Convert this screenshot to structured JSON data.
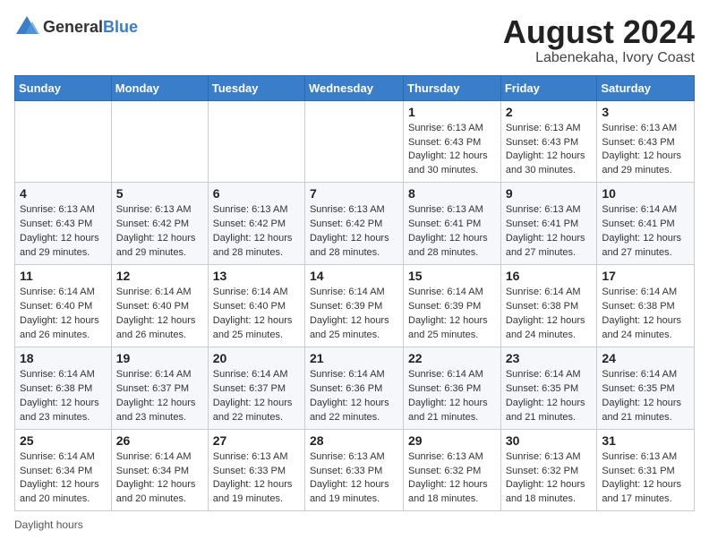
{
  "logo": {
    "general": "General",
    "blue": "Blue"
  },
  "title": "August 2024",
  "location": "Labenekaha, Ivory Coast",
  "days_header": [
    "Sunday",
    "Monday",
    "Tuesday",
    "Wednesday",
    "Thursday",
    "Friday",
    "Saturday"
  ],
  "footer": "Daylight hours",
  "weeks": [
    [
      {
        "day": "",
        "info": ""
      },
      {
        "day": "",
        "info": ""
      },
      {
        "day": "",
        "info": ""
      },
      {
        "day": "",
        "info": ""
      },
      {
        "day": "1",
        "info": "Sunrise: 6:13 AM\nSunset: 6:43 PM\nDaylight: 12 hours\nand 30 minutes."
      },
      {
        "day": "2",
        "info": "Sunrise: 6:13 AM\nSunset: 6:43 PM\nDaylight: 12 hours\nand 30 minutes."
      },
      {
        "day": "3",
        "info": "Sunrise: 6:13 AM\nSunset: 6:43 PM\nDaylight: 12 hours\nand 29 minutes."
      }
    ],
    [
      {
        "day": "4",
        "info": "Sunrise: 6:13 AM\nSunset: 6:43 PM\nDaylight: 12 hours\nand 29 minutes."
      },
      {
        "day": "5",
        "info": "Sunrise: 6:13 AM\nSunset: 6:42 PM\nDaylight: 12 hours\nand 29 minutes."
      },
      {
        "day": "6",
        "info": "Sunrise: 6:13 AM\nSunset: 6:42 PM\nDaylight: 12 hours\nand 28 minutes."
      },
      {
        "day": "7",
        "info": "Sunrise: 6:13 AM\nSunset: 6:42 PM\nDaylight: 12 hours\nand 28 minutes."
      },
      {
        "day": "8",
        "info": "Sunrise: 6:13 AM\nSunset: 6:41 PM\nDaylight: 12 hours\nand 28 minutes."
      },
      {
        "day": "9",
        "info": "Sunrise: 6:13 AM\nSunset: 6:41 PM\nDaylight: 12 hours\nand 27 minutes."
      },
      {
        "day": "10",
        "info": "Sunrise: 6:14 AM\nSunset: 6:41 PM\nDaylight: 12 hours\nand 27 minutes."
      }
    ],
    [
      {
        "day": "11",
        "info": "Sunrise: 6:14 AM\nSunset: 6:40 PM\nDaylight: 12 hours\nand 26 minutes."
      },
      {
        "day": "12",
        "info": "Sunrise: 6:14 AM\nSunset: 6:40 PM\nDaylight: 12 hours\nand 26 minutes."
      },
      {
        "day": "13",
        "info": "Sunrise: 6:14 AM\nSunset: 6:40 PM\nDaylight: 12 hours\nand 25 minutes."
      },
      {
        "day": "14",
        "info": "Sunrise: 6:14 AM\nSunset: 6:39 PM\nDaylight: 12 hours\nand 25 minutes."
      },
      {
        "day": "15",
        "info": "Sunrise: 6:14 AM\nSunset: 6:39 PM\nDaylight: 12 hours\nand 25 minutes."
      },
      {
        "day": "16",
        "info": "Sunrise: 6:14 AM\nSunset: 6:38 PM\nDaylight: 12 hours\nand 24 minutes."
      },
      {
        "day": "17",
        "info": "Sunrise: 6:14 AM\nSunset: 6:38 PM\nDaylight: 12 hours\nand 24 minutes."
      }
    ],
    [
      {
        "day": "18",
        "info": "Sunrise: 6:14 AM\nSunset: 6:38 PM\nDaylight: 12 hours\nand 23 minutes."
      },
      {
        "day": "19",
        "info": "Sunrise: 6:14 AM\nSunset: 6:37 PM\nDaylight: 12 hours\nand 23 minutes."
      },
      {
        "day": "20",
        "info": "Sunrise: 6:14 AM\nSunset: 6:37 PM\nDaylight: 12 hours\nand 22 minutes."
      },
      {
        "day": "21",
        "info": "Sunrise: 6:14 AM\nSunset: 6:36 PM\nDaylight: 12 hours\nand 22 minutes."
      },
      {
        "day": "22",
        "info": "Sunrise: 6:14 AM\nSunset: 6:36 PM\nDaylight: 12 hours\nand 21 minutes."
      },
      {
        "day": "23",
        "info": "Sunrise: 6:14 AM\nSunset: 6:35 PM\nDaylight: 12 hours\nand 21 minutes."
      },
      {
        "day": "24",
        "info": "Sunrise: 6:14 AM\nSunset: 6:35 PM\nDaylight: 12 hours\nand 21 minutes."
      }
    ],
    [
      {
        "day": "25",
        "info": "Sunrise: 6:14 AM\nSunset: 6:34 PM\nDaylight: 12 hours\nand 20 minutes."
      },
      {
        "day": "26",
        "info": "Sunrise: 6:14 AM\nSunset: 6:34 PM\nDaylight: 12 hours\nand 20 minutes."
      },
      {
        "day": "27",
        "info": "Sunrise: 6:13 AM\nSunset: 6:33 PM\nDaylight: 12 hours\nand 19 minutes."
      },
      {
        "day": "28",
        "info": "Sunrise: 6:13 AM\nSunset: 6:33 PM\nDaylight: 12 hours\nand 19 minutes."
      },
      {
        "day": "29",
        "info": "Sunrise: 6:13 AM\nSunset: 6:32 PM\nDaylight: 12 hours\nand 18 minutes."
      },
      {
        "day": "30",
        "info": "Sunrise: 6:13 AM\nSunset: 6:32 PM\nDaylight: 12 hours\nand 18 minutes."
      },
      {
        "day": "31",
        "info": "Sunrise: 6:13 AM\nSunset: 6:31 PM\nDaylight: 12 hours\nand 17 minutes."
      }
    ]
  ]
}
